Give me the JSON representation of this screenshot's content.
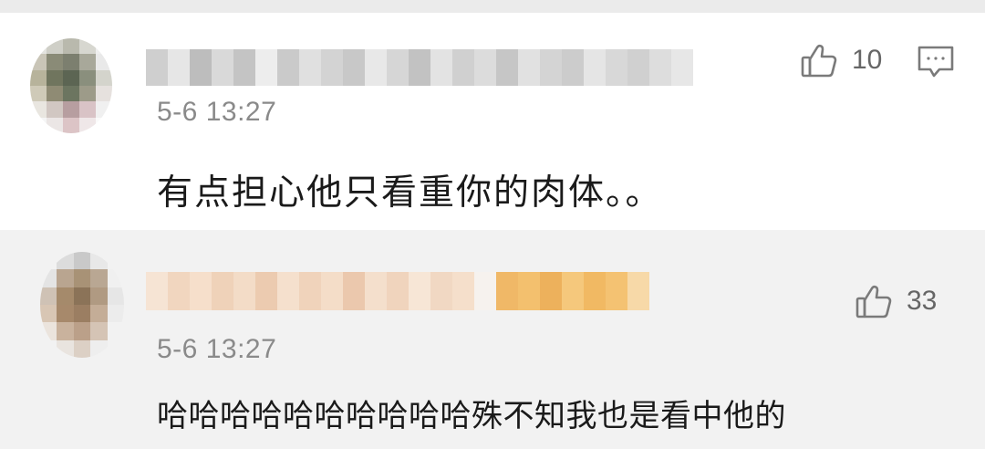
{
  "comments": [
    {
      "username": "",
      "timestamp": "5-6 13:27",
      "text": "有点担心他只看重你的肉体。。",
      "likes": "10",
      "like_icon": "thumbs-up-icon",
      "reply_icon": "comment-bubble-icon",
      "avatar_colors": [
        "#e3e3df",
        "#cfcfc7",
        "#b9b9ad",
        "#d7d7d0",
        "#eeeeee",
        "#c9c5b7",
        "#8a8b77",
        "#7c7f6f",
        "#a8a89a",
        "#e9e9e9",
        "#b7b39b",
        "#70755e",
        "#5c6553",
        "#8a8f7d",
        "#d4d4cc",
        "#cfcab8",
        "#8f8b74",
        "#6c7560",
        "#9d9b89",
        "#e6e1de",
        "#e9e6e0",
        "#d1c7c2",
        "#b79ea0",
        "#d9c3c6",
        "#f0f0f0",
        "#f5f5f5",
        "#ebe6e5",
        "#dcc4c6",
        "#efe7e8",
        "#fafafa"
      ],
      "username_colors": [
        "#cfcfcf",
        "#e6e6e6",
        "#bdbdbd",
        "#d9d9d9",
        "#c4c4c4",
        "#ededed",
        "#cacaca",
        "#e0e0e0",
        "#d3d3d3",
        "#c8c8c8",
        "#e8e8e8",
        "#d6d6d6",
        "#c2c2c2",
        "#e3e3e3",
        "#d0d0d0",
        "#dcdcdc",
        "#c6c6c6",
        "#e1e1e1",
        "#d4d4d4",
        "#cccccc",
        "#e5e5e5",
        "#d8d8d8",
        "#d0d0d0",
        "#dddddd",
        "#e7e7e7"
      ]
    },
    {
      "username": "",
      "timestamp": "5-6 13:27",
      "text": "哈哈哈哈哈哈哈哈哈哈殊不知我也是看中他的",
      "likes": "33",
      "like_icon": "thumbs-up-icon",
      "avatar_colors": [
        "#f2f2f2",
        "#dcdcdc",
        "#c9c9c9",
        "#e8e8e8",
        "#f2f2f2",
        "#e4e4e4",
        "#b9a590",
        "#a89276",
        "#b9a793",
        "#f0f0f0",
        "#cfc2b5",
        "#a58a6b",
        "#8b7358",
        "#b09a82",
        "#e6e6e6",
        "#d8c6b4",
        "#a7896b",
        "#9b7e62",
        "#c4ad97",
        "#ececec",
        "#ebe4dd",
        "#c9b29d",
        "#bba089",
        "#d5c4b5",
        "#f2f2f2",
        "#f2f2f2",
        "#e9e4df",
        "#dcd0c5",
        "#eeeeee",
        "#f2f2f2"
      ],
      "username_colors": [
        "#f6e4d4",
        "#f1d6bf",
        "#f6dfcb",
        "#efd2b9",
        "#f3dcc7",
        "#eccbb0",
        "#f5e0cd",
        "#f0d3bb",
        "#f4ddc8",
        "#ebc8ad",
        "#f4dfcc",
        "#f0d4bd",
        "#f7e6d6",
        "#f1d8c3",
        "#f5dfcb",
        "#f6f2ee",
        "#f0b867",
        "#f3c06e",
        "#edb15c",
        "#f5c87c",
        "#f1b963",
        "#f4c272",
        "#f7d9a8",
        "#f2f2f2",
        "#f2f2f2"
      ]
    }
  ]
}
